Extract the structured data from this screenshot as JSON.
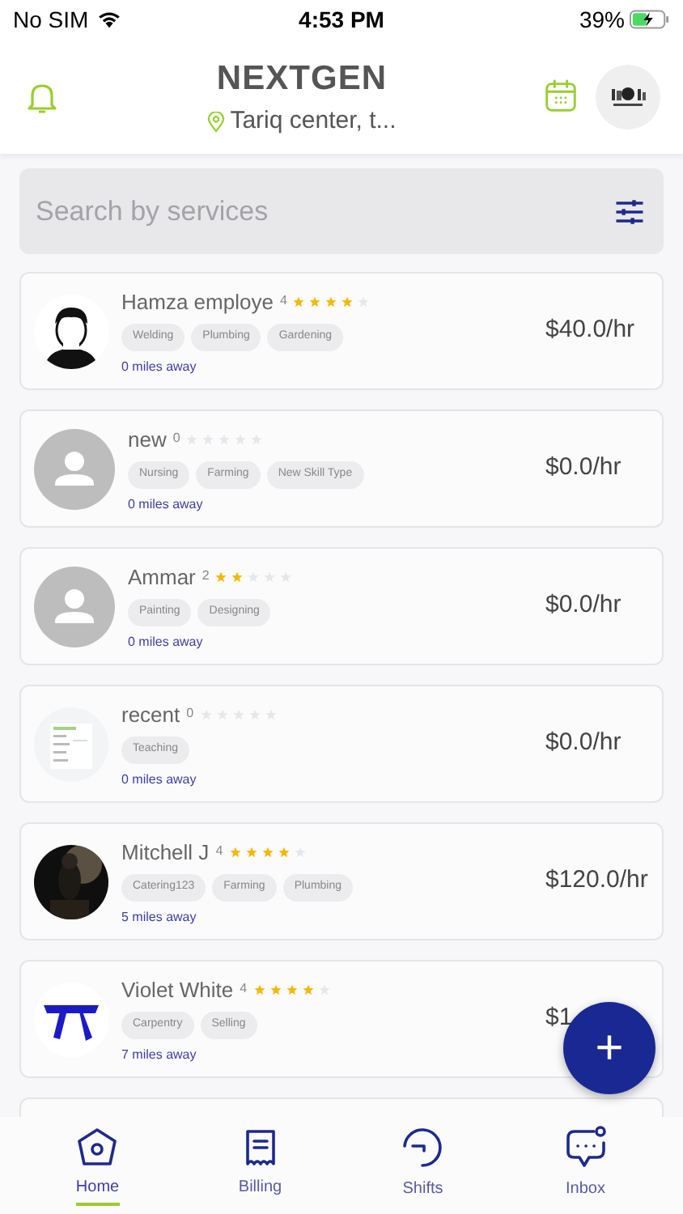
{
  "status_bar": {
    "carrier": "No SIM",
    "time": "4:53 PM",
    "battery": "39%"
  },
  "header": {
    "title": "NEXTGEN",
    "location": "Tariq center, t..."
  },
  "search": {
    "placeholder": "Search by services"
  },
  "workers": [
    {
      "name": "Hamza employe",
      "rating": "4",
      "stars": 4,
      "skills": [
        "Welding",
        "Plumbing",
        "Gardening"
      ],
      "distance": "0 miles away",
      "price": "$40.0/hr",
      "kind": "picture"
    },
    {
      "name": "new",
      "rating": "0",
      "stars": 0,
      "skills": [
        "Nursing",
        "Farming",
        "New Skill Type"
      ],
      "distance": "0 miles away",
      "price": "$0.0/hr",
      "kind": "placeholder"
    },
    {
      "name": "Ammar",
      "rating": "2",
      "stars": 2,
      "skills": [
        "Painting",
        "Designing"
      ],
      "distance": "0 miles away",
      "price": "$0.0/hr",
      "kind": "placeholder"
    },
    {
      "name": "recent",
      "rating": "0",
      "stars": 0,
      "skills": [
        "Teaching"
      ],
      "distance": "0 miles away",
      "price": "$0.0/hr",
      "kind": "picture"
    },
    {
      "name": "Mitchell J",
      "rating": "4",
      "stars": 4,
      "skills": [
        "Catering123",
        "Farming",
        "Plumbing"
      ],
      "distance": "5 miles away",
      "price": "$120.0/hr",
      "kind": "picture"
    },
    {
      "name": "Violet White",
      "rating": "4",
      "stars": 4,
      "skills": [
        "Carpentry",
        "Selling"
      ],
      "distance": "7 miles away",
      "price": "$1",
      "kind": "picture"
    }
  ],
  "fab": {
    "label": "+"
  },
  "tabs": [
    {
      "label": "Home",
      "selected": true
    },
    {
      "label": "Billing",
      "selected": false
    },
    {
      "label": "Shifts",
      "selected": false
    },
    {
      "label": "Inbox",
      "selected": false
    }
  ]
}
